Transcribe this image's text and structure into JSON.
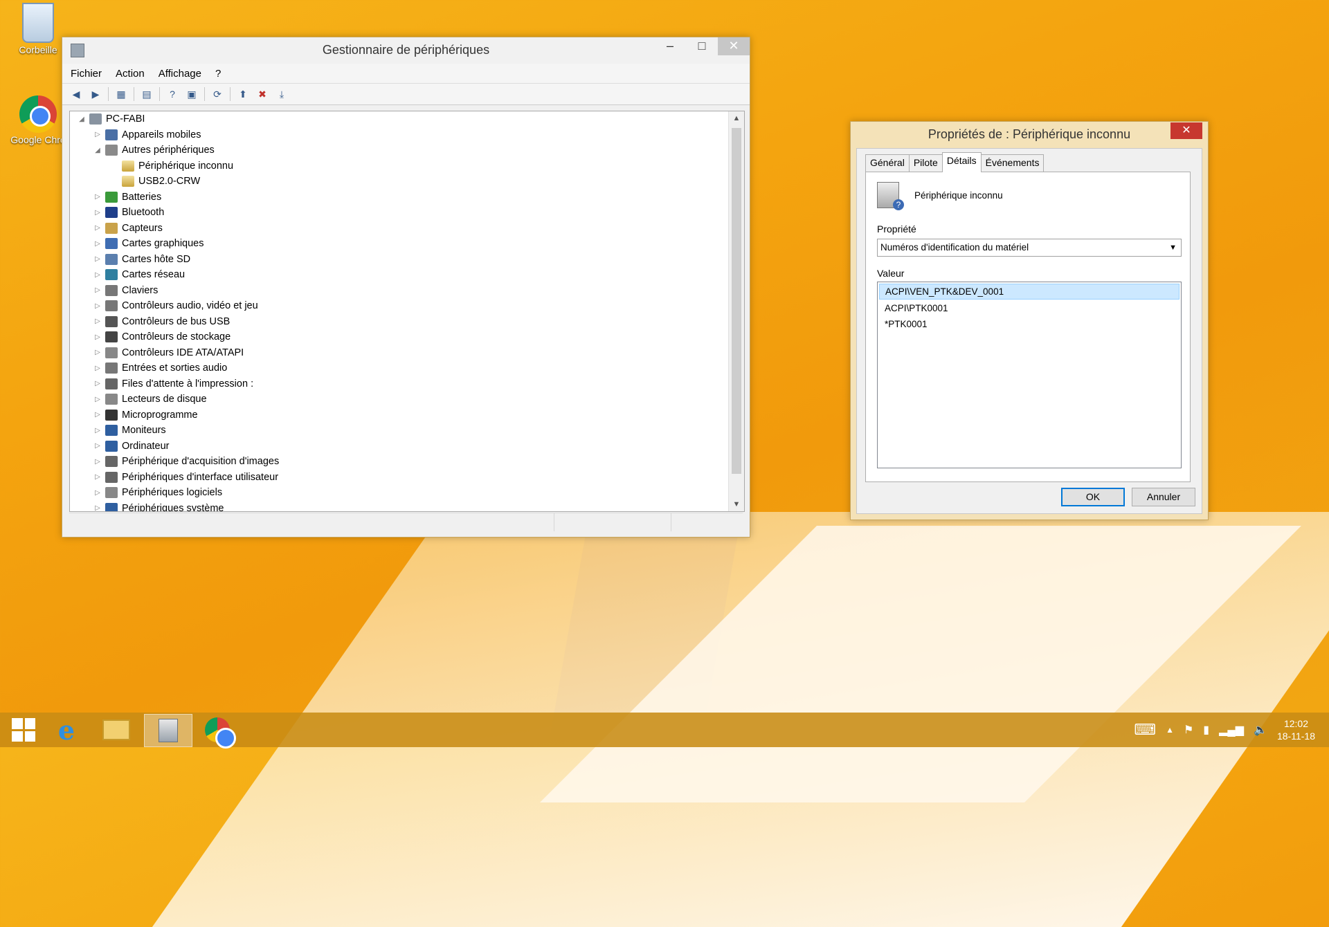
{
  "desktop": {
    "icons": [
      {
        "label": "Corbeille",
        "icon": "recycle-bin-icon"
      },
      {
        "label": "Google Chro",
        "icon": "chrome-icon"
      }
    ]
  },
  "device_manager": {
    "title": "Gestionnaire de périphériques",
    "menu": [
      "Fichier",
      "Action",
      "Affichage",
      "?"
    ],
    "tree": {
      "root": "PC-FABI",
      "categories": [
        {
          "label": "Appareils mobiles",
          "expanded": false,
          "color": "#4a6fa5"
        },
        {
          "label": "Autres périphériques",
          "expanded": true,
          "color": "#8a8a8a",
          "children": [
            "Périphérique inconnu",
            "USB2.0-CRW"
          ]
        },
        {
          "label": "Batteries",
          "expanded": false,
          "color": "#3a9a3a"
        },
        {
          "label": "Bluetooth",
          "expanded": false,
          "color": "#1f3f8a"
        },
        {
          "label": "Capteurs",
          "expanded": false,
          "color": "#c9a24a"
        },
        {
          "label": "Cartes graphiques",
          "expanded": false,
          "color": "#3f6db3"
        },
        {
          "label": "Cartes hôte SD",
          "expanded": false,
          "color": "#5b7fae"
        },
        {
          "label": "Cartes réseau",
          "expanded": false,
          "color": "#2f7fa0"
        },
        {
          "label": "Claviers",
          "expanded": false,
          "color": "#777777"
        },
        {
          "label": "Contrôleurs audio, vidéo et jeu",
          "expanded": false,
          "color": "#777777"
        },
        {
          "label": "Contrôleurs de bus USB",
          "expanded": false,
          "color": "#555555"
        },
        {
          "label": "Contrôleurs de stockage",
          "expanded": false,
          "color": "#444444"
        },
        {
          "label": "Contrôleurs IDE ATA/ATAPI",
          "expanded": false,
          "color": "#888888"
        },
        {
          "label": "Entrées et sorties audio",
          "expanded": false,
          "color": "#777777"
        },
        {
          "label": "Files d'attente à l'impression :",
          "expanded": false,
          "color": "#666666"
        },
        {
          "label": "Lecteurs de disque",
          "expanded": false,
          "color": "#888888"
        },
        {
          "label": "Microprogramme",
          "expanded": false,
          "color": "#333333"
        },
        {
          "label": "Moniteurs",
          "expanded": false,
          "color": "#2f5fa0"
        },
        {
          "label": "Ordinateur",
          "expanded": false,
          "color": "#2f5fa0"
        },
        {
          "label": "Périphérique d'acquisition d'images",
          "expanded": false,
          "color": "#666666"
        },
        {
          "label": "Périphériques d'interface utilisateur",
          "expanded": false,
          "color": "#666666"
        },
        {
          "label": "Périphériques logiciels",
          "expanded": false,
          "color": "#888888"
        },
        {
          "label": "Périphériques système",
          "expanded": false,
          "color": "#2f5fa0"
        }
      ]
    }
  },
  "properties_dialog": {
    "title": "Propriétés de : Périphérique inconnu",
    "tabs": [
      "Général",
      "Pilote",
      "Détails",
      "Événements"
    ],
    "active_tab": "Détails",
    "device_name": "Périphérique inconnu",
    "property_label": "Propriété",
    "property_value": "Numéros d'identification du matériel",
    "value_label": "Valeur",
    "values": [
      "ACPI\\VEN_PTK&DEV_0001",
      "ACPI\\PTK0001",
      "*PTK0001"
    ],
    "selected_value_index": 0,
    "ok_label": "OK",
    "cancel_label": "Annuler"
  },
  "taskbar": {
    "apps": [
      "start-icon",
      "internet-explorer-icon",
      "file-explorer-icon",
      "device-manager-icon",
      "chrome-icon"
    ],
    "time": "12:02",
    "date": "18-11-18"
  }
}
